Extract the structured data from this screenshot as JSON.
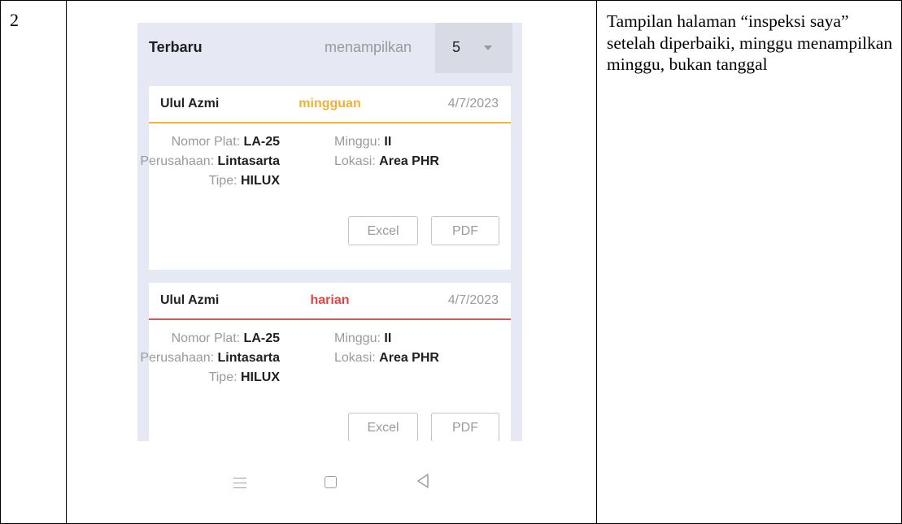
{
  "row_number": "2",
  "description": "Tampilan halaman “inspeksi saya” setelah diperbaiki, minggu menampilkan minggu, bukan tanggal",
  "screen": {
    "filter": {
      "title": "Terbaru",
      "label": "menampilkan",
      "value": "5"
    },
    "cards": [
      {
        "name": "Ulul Azmi",
        "type": "mingguan",
        "date": "4/7/2023",
        "plat_label": "Nomor Plat:",
        "plat": "LA-25",
        "perusahaan_label": "Perusahaan:",
        "perusahaan": "Lintasarta",
        "tipe_label": "Tipe:",
        "tipe": "HILUX",
        "minggu_label": "Minggu:",
        "minggu": "II",
        "lokasi_label": "Lokasi:",
        "lokasi": "Area PHR",
        "excel_label": "Excel",
        "pdf_label": "PDF"
      },
      {
        "name": "Ulul Azmi",
        "type": "harian",
        "date": "4/7/2023",
        "plat_label": "Nomor Plat:",
        "plat": "LA-25",
        "perusahaan_label": "Perusahaan:",
        "perusahaan": "Lintasarta",
        "tipe_label": "Tipe:",
        "tipe": "HILUX",
        "minggu_label": "Minggu:",
        "minggu": "II",
        "lokasi_label": "Lokasi:",
        "lokasi": "Area PHR",
        "excel_label": "Excel",
        "pdf_label": "PDF"
      }
    ],
    "navbar": {
      "icons": [
        "menu-icon",
        "home-icon",
        "back-icon"
      ]
    },
    "colors": {
      "weekly": "#efb236",
      "daily": "#e04545",
      "background": "#e6e9f3"
    }
  }
}
